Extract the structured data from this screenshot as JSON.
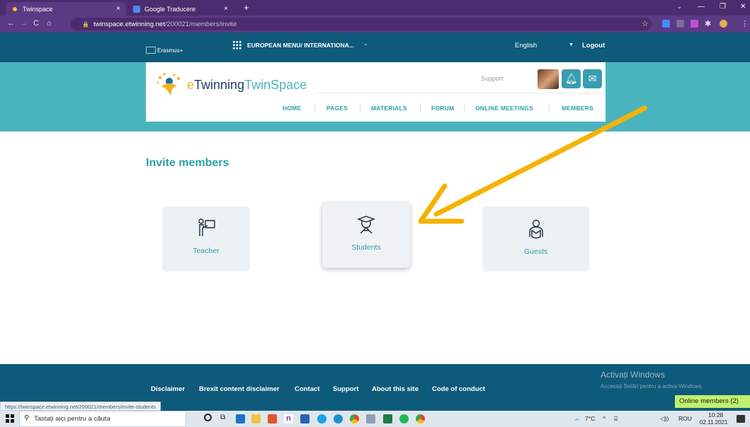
{
  "browser": {
    "tabs": [
      {
        "label": "Twinspace",
        "close": "×"
      },
      {
        "label": "Google Traducere",
        "close": "×"
      }
    ],
    "new_tab": "+",
    "url_host": "twinspace.etwinning.net",
    "url_path": "/200021/members/invite",
    "window_controls": [
      "⌄",
      "—",
      "❐",
      "✕"
    ]
  },
  "site_nav": {
    "erasmus": "Erasmus+",
    "european_menu": "EUROPEAN MENU/ INTERNATIONA...",
    "language": "English",
    "logout": "Logout"
  },
  "header": {
    "logo_e": "e",
    "logo_twinning": "Twinning",
    "logo_twinspace": "TwinSpace",
    "support": "Support",
    "menu": [
      "HOME",
      "PAGES",
      "MATERIALS",
      "FORUM",
      "ONLINE MEETINGS",
      "MEMBERS"
    ]
  },
  "main": {
    "title": "Invite members",
    "cards": [
      {
        "label": "Teacher",
        "icon": "teacher-icon"
      },
      {
        "label": "Students",
        "icon": "students-icon"
      },
      {
        "label": "Guests",
        "icon": "guests-icon"
      }
    ],
    "arrow_color": "#f5b301"
  },
  "footer": {
    "links": [
      "Disclaimer",
      "Brexit content disclaimer",
      "Contact",
      "Support",
      "About this site",
      "Code of conduct"
    ],
    "status_url": "https://twinspace.etwinning.net/200021/members/invite-students",
    "online_members": "Online members (2)",
    "activate_title": "Activați Windows",
    "activate_sub": "Accesați Setări pentru a activa Windows."
  },
  "taskbar": {
    "search_placeholder": "Tastați aici pentru a căuta",
    "temperature": "7°C",
    "language": "ROU",
    "time": "10:28",
    "date": "02.11.2021"
  },
  "colors": {
    "accent": "#2ea0a8",
    "nav_bg": "#0e5a7a",
    "hero_bg": "#4ab4be",
    "browser_bg": "#5b3a84"
  }
}
